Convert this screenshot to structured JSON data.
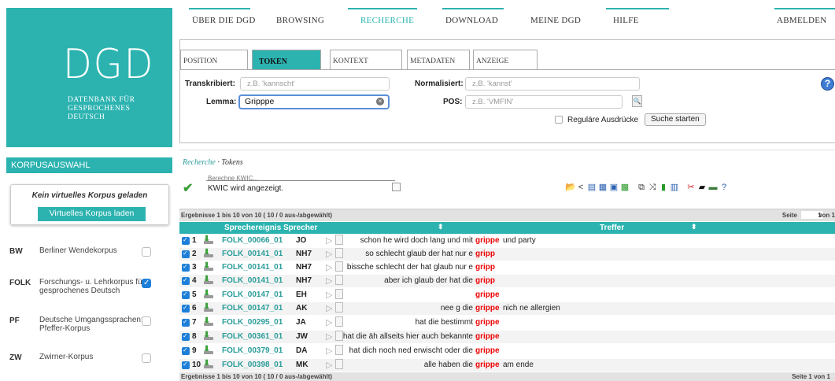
{
  "logo": {
    "big": "DGD",
    "line1": "DATENBANK FÜR",
    "line2": "GESPROCHENES",
    "line3": "DEUTSCH"
  },
  "nav": {
    "items": [
      "ÜBER DIE DGD",
      "BROWSING",
      "RECHERCHE",
      "DOWNLOAD",
      "MEINE DGD",
      "HILFE",
      "ABMELDEN"
    ],
    "active": "RECHERCHE"
  },
  "sidebar": {
    "header": "KORPUSAUSWAHL",
    "virtual_msg": "Kein virtuelles Korpus geladen",
    "virtual_btn": "Virtuelles Korpus laden",
    "corpora": [
      {
        "abbr": "BW",
        "name": "Berliner Wendekorpus",
        "checked": false
      },
      {
        "abbr": "FOLK",
        "name": "Forschungs- u. Lehrkorpus für gesprochenes Deutsch",
        "checked": true
      },
      {
        "abbr": "PF",
        "name": "Deutsche Umgangssprachen: Pfeffer-Korpus",
        "checked": false
      },
      {
        "abbr": "ZW",
        "name": "Zwirner-Korpus",
        "checked": false
      }
    ]
  },
  "search": {
    "tabs": [
      "POSITION",
      "TOKEN",
      "KONTEXT",
      "METADATEN",
      "ANZEIGE"
    ],
    "active_tab": "TOKEN",
    "transkribiert_label": "Transkribiert:",
    "transkribiert_placeholder": "z.B. 'kannscht'",
    "normalisiert_label": "Normalisiert:",
    "normalisiert_placeholder": "z.B. 'kannst'",
    "lemma_label": "Lemma:",
    "lemma_value": "Gripppe",
    "pos_label": "POS:",
    "pos_placeholder": "z.B. 'VMFIN'",
    "regex_label": "Reguläre Ausdrücke",
    "start_label": "Suche starten",
    "help": "?"
  },
  "breadcrumb": {
    "link": "Recherche",
    "sep": " · ",
    "current": "Tokens"
  },
  "status": {
    "line1": "Berechne KWIC...",
    "line2": "KWIC wird angezeigt."
  },
  "results": {
    "info": "Ergebnisse 1 bis 10 von 10 ( 10 / 0 aus-/abgewählt)",
    "page_label": "Seite",
    "page_value": "1",
    "page_total": "von 1",
    "footer_info": "Ergebnisse 1 bis 10 von 10 ( 10 / 0 aus-/abgewählt)",
    "footer_page": "Seite 1 von 1",
    "headers": {
      "event": "Sprechereignis",
      "speaker": "Sprecher",
      "hit": "Treffer"
    },
    "rows": [
      {
        "n": "1",
        "event": "FOLK_00066_01",
        "speaker": "JO",
        "left": "schon he wird doch lang und mit",
        "hit": "grippe",
        "right": "und party"
      },
      {
        "n": "2",
        "event": "FOLK_00141_01",
        "speaker": "NH7",
        "left": "so schlecht glaub der hat nur e",
        "hit": "gripp",
        "right": ""
      },
      {
        "n": "3",
        "event": "FOLK_00141_01",
        "speaker": "NH7",
        "left": "bissche schlecht der hat glaub nur e",
        "hit": "gripp",
        "right": ""
      },
      {
        "n": "4",
        "event": "FOLK_00141_01",
        "speaker": "NH7",
        "left": "aber ich glaub der hat die",
        "hit": "gripp",
        "right": ""
      },
      {
        "n": "5",
        "event": "FOLK_00147_01",
        "speaker": "EH",
        "left": "",
        "hit": "grippe",
        "right": ""
      },
      {
        "n": "6",
        "event": "FOLK_00147_01",
        "speaker": "AK",
        "left": "nee g die",
        "hit": "grippe",
        "right": "nich ne allergien"
      },
      {
        "n": "7",
        "event": "FOLK_00295_01",
        "speaker": "JA",
        "left": "hat die bestimmt",
        "hit": "grippe",
        "right": ""
      },
      {
        "n": "8",
        "event": "FOLK_00361_01",
        "speaker": "JW",
        "left": "hat die äh allseits hier auch bekannte",
        "hit": "grippe",
        "right": ""
      },
      {
        "n": "9",
        "event": "FOLK_00379_01",
        "speaker": "DA",
        "left": "hat dich noch ned erwischt oder die",
        "hit": "grippe",
        "right": ""
      },
      {
        "n": "10",
        "event": "FOLK_00398_01",
        "speaker": "MK",
        "left": "alle haben die",
        "hit": "grippe",
        "right": "am ende"
      }
    ]
  },
  "colors": {
    "accent": "#2cb3b0",
    "hit": "#ee0000",
    "checkbox": "#1e7fd8"
  }
}
